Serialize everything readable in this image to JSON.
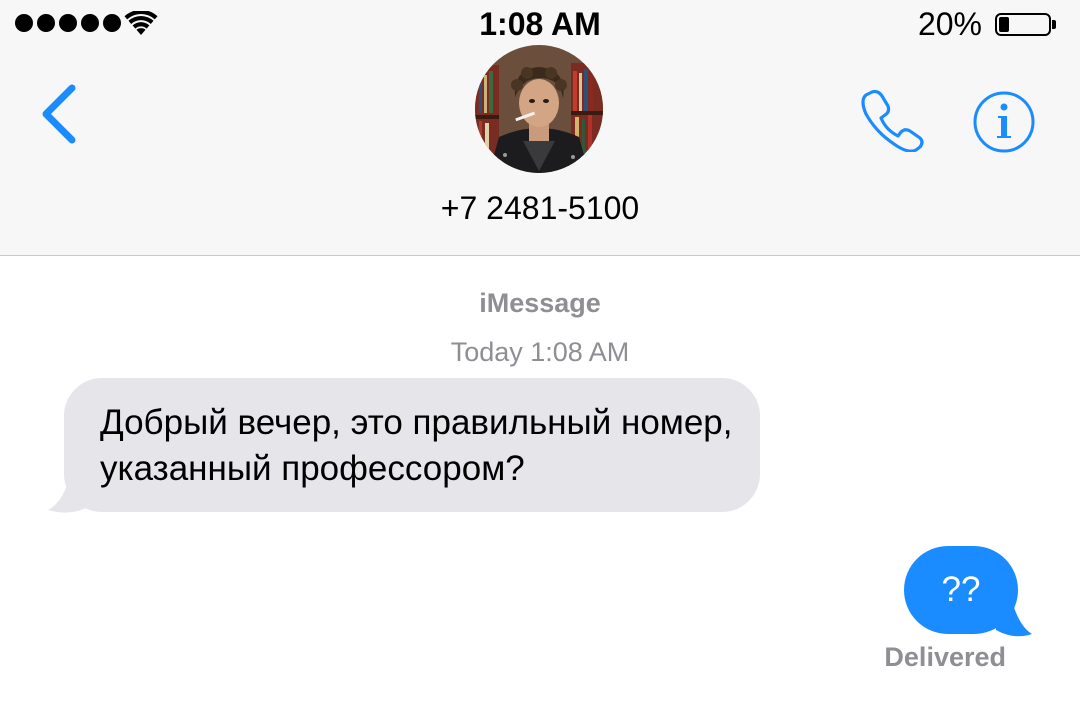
{
  "status_bar": {
    "signal_bars": 5,
    "time": "1:08 AM",
    "battery_percent_text": "20%",
    "battery_level": 0.2
  },
  "header": {
    "back_icon": "chevron-left-icon",
    "contact_phone": "+7 2481-5100",
    "call_icon": "phone-icon",
    "info_icon": "info-circle-icon",
    "accent_color": "#1a8cff"
  },
  "conversation": {
    "service": "iMessage",
    "timestamp": "Today 1:08 AM",
    "messages": [
      {
        "direction": "incoming",
        "text": "Добрый вечер, это правильный номер, указанный профессором?"
      },
      {
        "direction": "outgoing",
        "text": "??"
      }
    ],
    "delivery_status": "Delivered"
  },
  "colors": {
    "incoming_bubble": "#e5e5ea",
    "outgoing_bubble": "#1a8cff",
    "secondary_text": "#8e8e93"
  }
}
